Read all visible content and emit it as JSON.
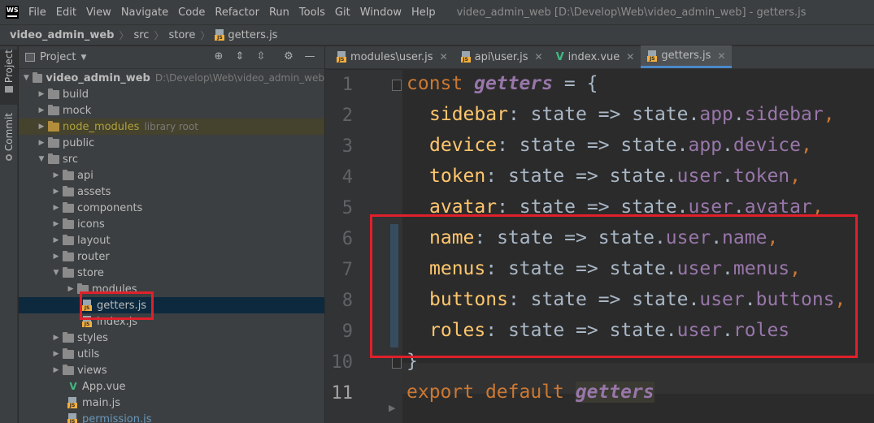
{
  "app": {
    "logo_text": "WS",
    "window_title": "video_admin_web [D:\\Develop\\Web\\video_admin_web] - getters.js",
    "menu": [
      "File",
      "Edit",
      "View",
      "Navigate",
      "Code",
      "Refactor",
      "Run",
      "Tools",
      "Git",
      "Window",
      "Help"
    ]
  },
  "breadcrumb": [
    "video_admin_web",
    "src",
    "store",
    "getters.js"
  ],
  "toolstrip": {
    "project_label": "Project",
    "commit_label": "Commit"
  },
  "project_panel": {
    "title": "Project",
    "tools": [
      "locate-icon",
      "expand-all-icon",
      "collapse-all-icon",
      "gear-icon",
      "hide-icon"
    ],
    "tree": [
      {
        "name": "video_admin_web",
        "hint": "D:\\Develop\\Web\\video_admin_web"
      },
      {
        "name": "build"
      },
      {
        "name": "mock"
      },
      {
        "name": "node_modules",
        "hint": "library root"
      },
      {
        "name": "public"
      },
      {
        "name": "src"
      },
      {
        "name": "api"
      },
      {
        "name": "assets"
      },
      {
        "name": "components"
      },
      {
        "name": "icons"
      },
      {
        "name": "layout"
      },
      {
        "name": "router"
      },
      {
        "name": "store"
      },
      {
        "name": "modules"
      },
      {
        "name": "getters.js"
      },
      {
        "name": "index.js"
      },
      {
        "name": "styles"
      },
      {
        "name": "utils"
      },
      {
        "name": "views"
      },
      {
        "name": "App.vue"
      },
      {
        "name": "main.js"
      },
      {
        "name": "permission.js"
      }
    ]
  },
  "editor": {
    "tabs": [
      {
        "label": "modules\\user.js",
        "icon": "js-file-icon"
      },
      {
        "label": "api\\user.js",
        "icon": "js-file-icon"
      },
      {
        "label": "index.vue",
        "icon": "vue-file-icon"
      },
      {
        "label": "getters.js",
        "icon": "js-file-icon",
        "active": true
      }
    ],
    "line_numbers": [
      "1",
      "2",
      "3",
      "4",
      "5",
      "6",
      "7",
      "8",
      "9",
      "10",
      "11"
    ],
    "current_line": "11",
    "code": {
      "l1": {
        "kw": "const",
        "ident": "getters",
        "rest": " = {"
      },
      "lines": [
        {
          "key": "sidebar",
          "obj": "app",
          "field": "sidebar"
        },
        {
          "key": "device",
          "obj": "app",
          "field": "device"
        },
        {
          "key": "token",
          "obj": "user",
          "field": "token"
        },
        {
          "key": "avatar",
          "obj": "user",
          "field": "avatar"
        },
        {
          "key": "name",
          "obj": "user",
          "field": "name"
        },
        {
          "key": "menus",
          "obj": "user",
          "field": "menus"
        },
        {
          "key": "buttons",
          "obj": "user",
          "field": "buttons"
        },
        {
          "key": "roles",
          "obj": "user",
          "field": "roles"
        }
      ],
      "arrow_text": ": state => state.",
      "dot": ".",
      "comma": ",",
      "l10": "}",
      "l11": {
        "kw1": "export",
        "kw2": "default",
        "ident": "getters"
      }
    }
  },
  "colors": {
    "highlight": "#e0202a",
    "keyword": "#cc7832",
    "identifier": "#9876aa",
    "property": "#ffc66d",
    "text": "#a9b7c6"
  }
}
